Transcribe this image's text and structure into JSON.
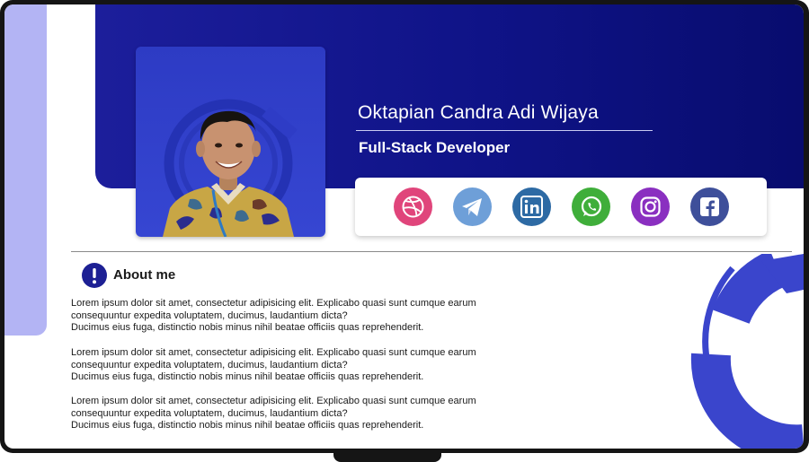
{
  "profile": {
    "name": "Oktapian Candra Adi Wijaya",
    "role": "Full-Stack Developer"
  },
  "social_links": [
    {
      "name": "Dribbble",
      "icon": "dribbble-icon",
      "color": "#e0457b"
    },
    {
      "name": "Telegram",
      "icon": "telegram-icon",
      "color": "#6e9fd8"
    },
    {
      "name": "LinkedIn",
      "icon": "linkedin-icon",
      "color": "#2d6aa4"
    },
    {
      "name": "WhatsApp",
      "icon": "whatsapp-icon",
      "color": "#3fae3a"
    },
    {
      "name": "Instagram",
      "icon": "instagram-icon",
      "color": "#8a2fc0"
    },
    {
      "name": "Facebook",
      "icon": "facebook-icon",
      "color": "#3e4f9a"
    }
  ],
  "about": {
    "title": "About me",
    "icon": "exclamation-icon",
    "paragraphs": [
      "Lorem ipsum dolor sit amet, consectetur adipisicing elit. Explicabo quasi sunt cumque earum\nconsequuntur expedita voluptatem, ducimus, laudantium dicta?\n Ducimus eius fuga, distinctio nobis minus nihil beatae officiis quas reprehenderit.",
      "Lorem ipsum dolor sit amet, consectetur adipisicing elit. Explicabo quasi sunt cumque earum\nconsequuntur expedita voluptatem, ducimus, laudantium dicta?\n Ducimus eius fuga, distinctio nobis minus nihil beatae officiis quas reprehenderit.",
      "Lorem ipsum dolor sit amet, consectetur adipisicing elit. Explicabo quasi sunt cumque earum\nconsequuntur expedita voluptatem, ducimus, laudantium dicta?\n Ducimus eius fuga, distinctio nobis minus nihil beatae officiis quas reprehenderit."
    ]
  },
  "colors": {
    "banner": "#0f1387",
    "sidebar": "#b3b4f4",
    "accent": "#3a45cc",
    "icon_badge": "#1d2094"
  }
}
